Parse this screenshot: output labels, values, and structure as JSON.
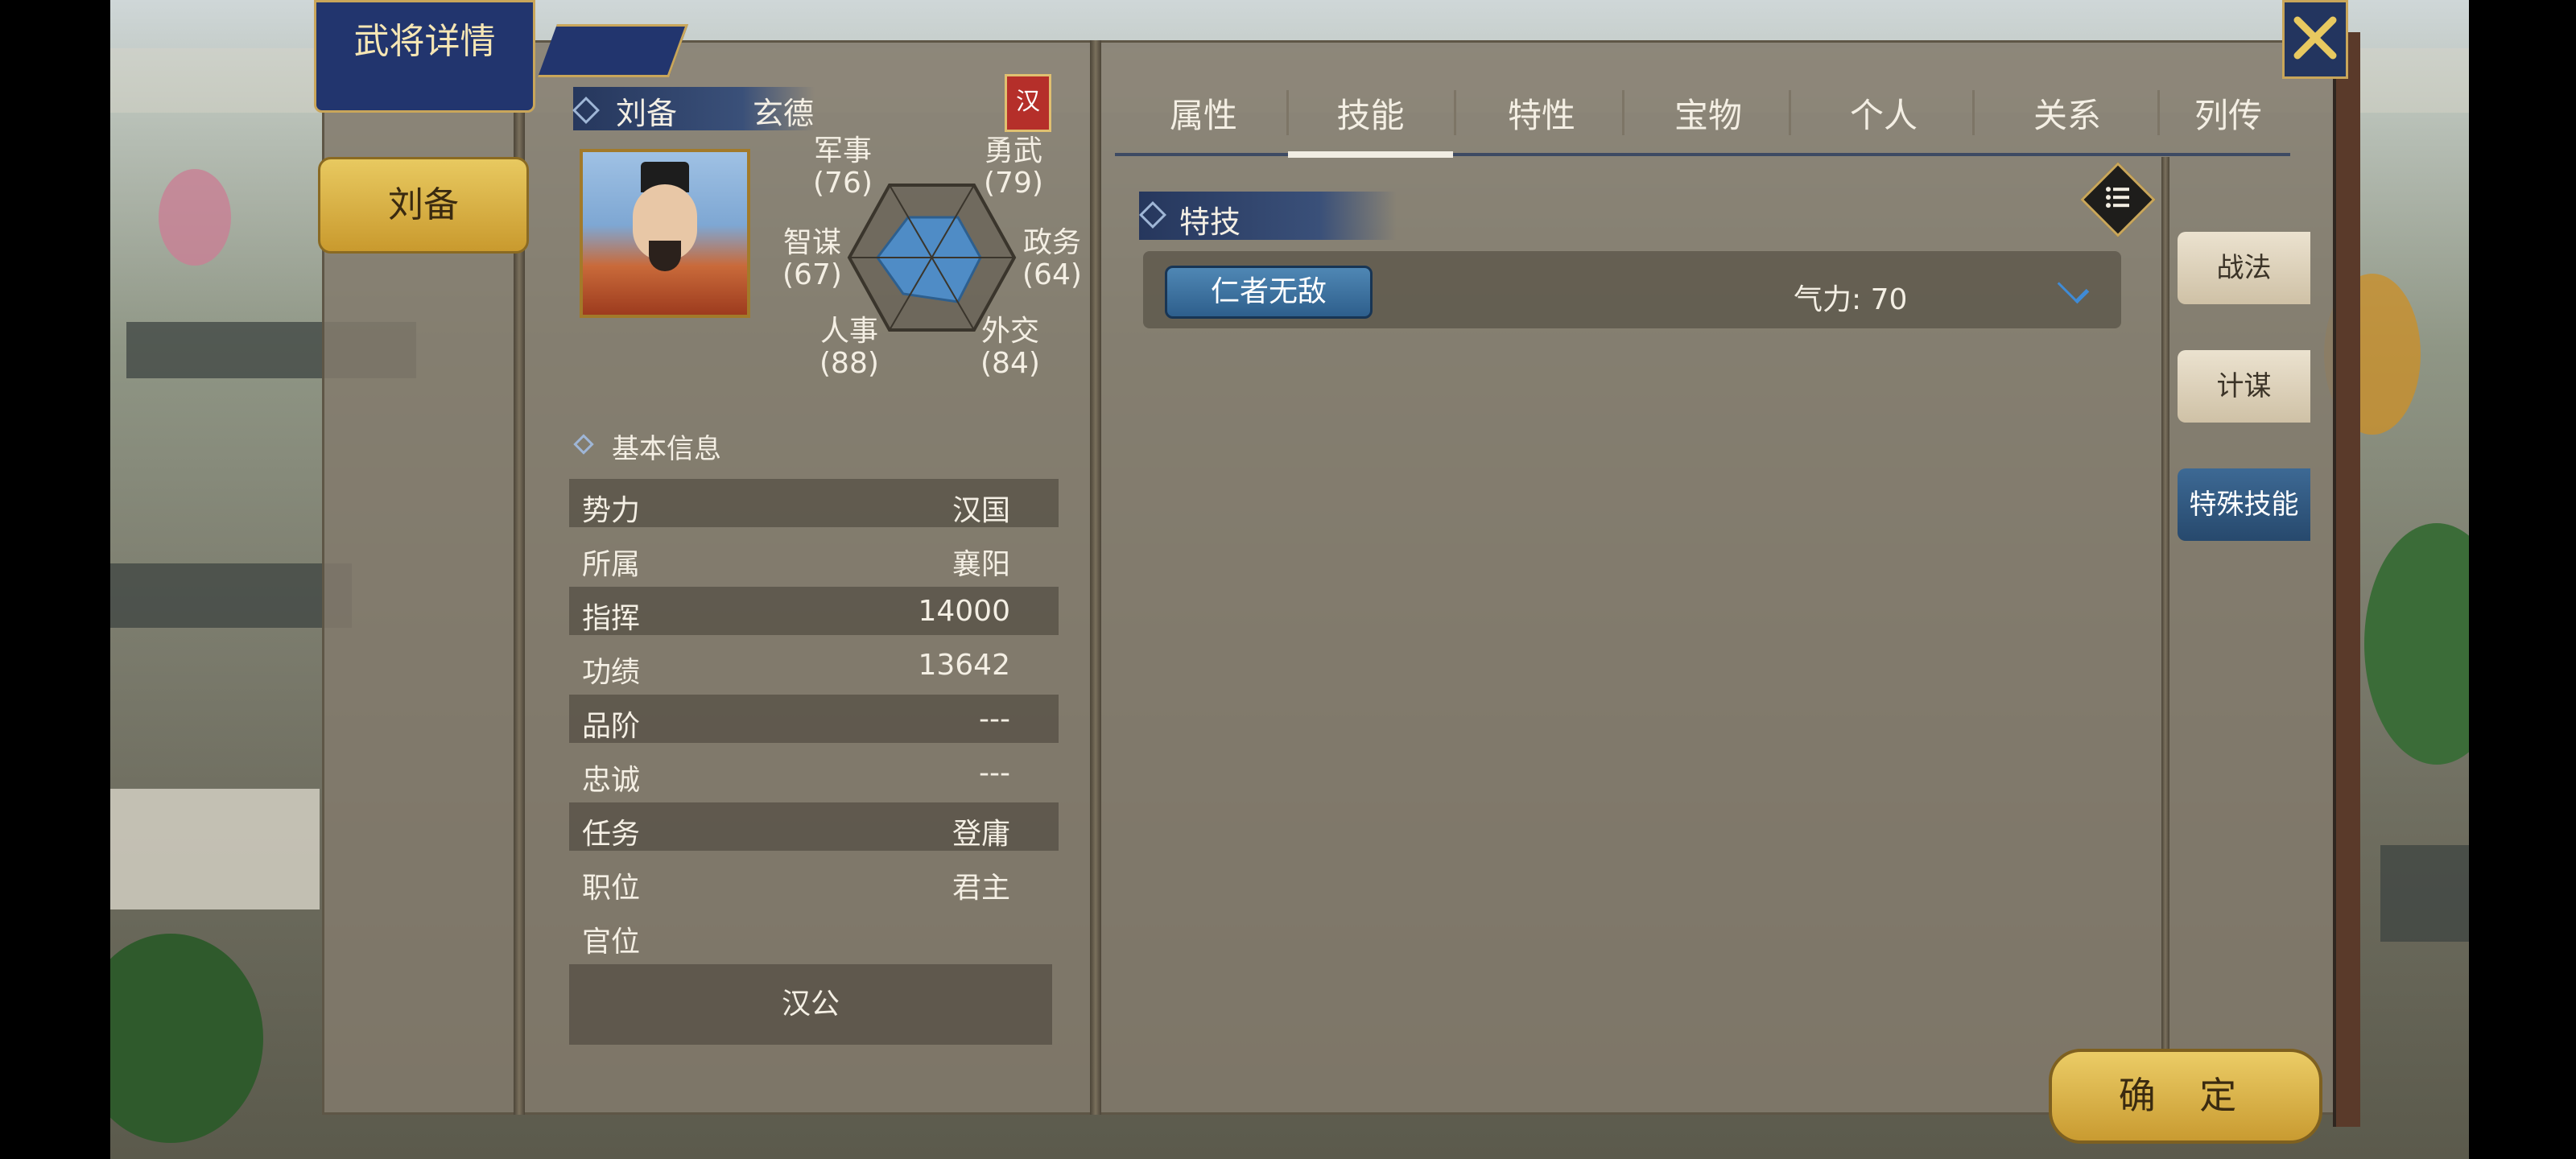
{
  "window": {
    "title": "武将详情",
    "close_icon": "close-x-icon"
  },
  "sidebar": {
    "selected_hero": "刘备"
  },
  "hero": {
    "name": "刘备",
    "style_name": "玄德",
    "faction_badge": "汉",
    "portrait": "hero-portrait"
  },
  "stats": {
    "military": {
      "label": "军事",
      "value": "(76)"
    },
    "valor": {
      "label": "勇武",
      "value": "(79)"
    },
    "strategy": {
      "label": "智谋",
      "value": "(67)"
    },
    "politics": {
      "label": "政务",
      "value": "(64)"
    },
    "personnel": {
      "label": "人事",
      "value": "(88)"
    },
    "diplomacy": {
      "label": "外交",
      "value": "(84)"
    }
  },
  "basic_info": {
    "title": "基本信息",
    "rows": [
      {
        "key": "势力",
        "value": "汉国"
      },
      {
        "key": "所属",
        "value": "襄阳"
      },
      {
        "key": "指挥",
        "value": "14000"
      },
      {
        "key": "功绩",
        "value": "13642"
      },
      {
        "key": "品阶",
        "value": "---"
      },
      {
        "key": "忠诚",
        "value": "---"
      },
      {
        "key": "任务",
        "value": "登庸"
      },
      {
        "key": "职位",
        "value": "君主"
      },
      {
        "key": "官位",
        "value": ""
      }
    ],
    "rank_title": "汉公"
  },
  "tabs": [
    {
      "label": "属性"
    },
    {
      "label": "技能",
      "active": true
    },
    {
      "label": "特性"
    },
    {
      "label": "宝物"
    },
    {
      "label": "个人"
    },
    {
      "label": "关系"
    },
    {
      "label": "列传"
    }
  ],
  "skills": {
    "section_title": "特技",
    "skill_name": "仁者无敌",
    "qi_text": "气力: 70",
    "list_icon": "list-icon"
  },
  "side_tabs": [
    {
      "label": "战法"
    },
    {
      "label": "计谋"
    },
    {
      "label": "特殊技能",
      "active": true
    }
  ],
  "confirm_label": "确 定",
  "colors": {
    "accent_blue": "#2e5f8c",
    "gold": "#c99b31",
    "faction_red": "#b52f2a"
  }
}
